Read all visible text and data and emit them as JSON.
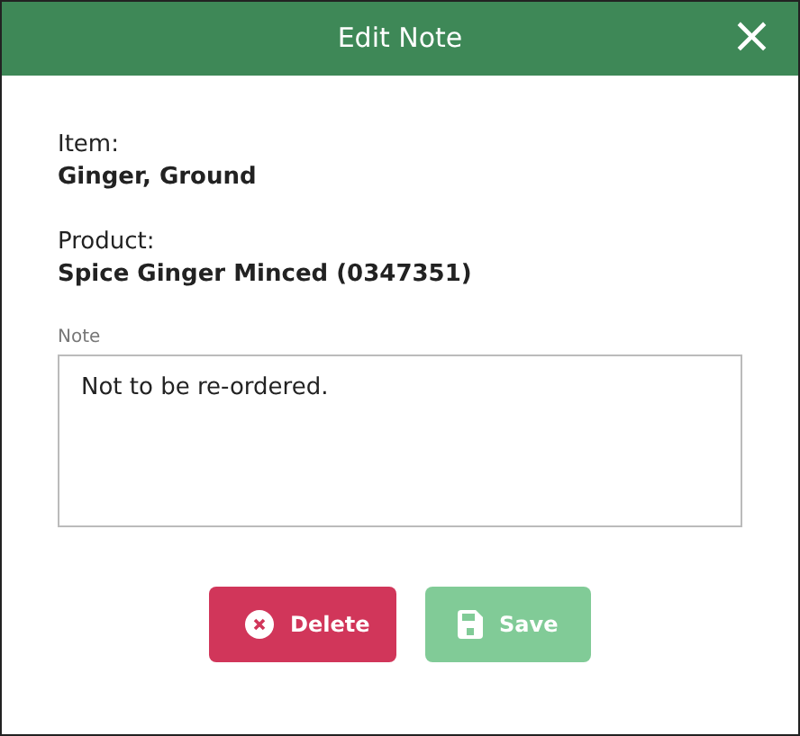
{
  "dialog": {
    "title": "Edit Note",
    "close": "×"
  },
  "fields": [
    {
      "label": "Item:",
      "value": "Ginger, Ground"
    },
    {
      "label": "Product:",
      "value": "Spice Ginger Minced (0347351)"
    }
  ],
  "note": {
    "label": "Note",
    "value": "Not to be re-ordered."
  },
  "buttons": [
    {
      "kind": "delete",
      "label": "Delete",
      "disabled": false
    },
    {
      "kind": "save",
      "label": "Save",
      "disabled": true
    }
  ]
}
